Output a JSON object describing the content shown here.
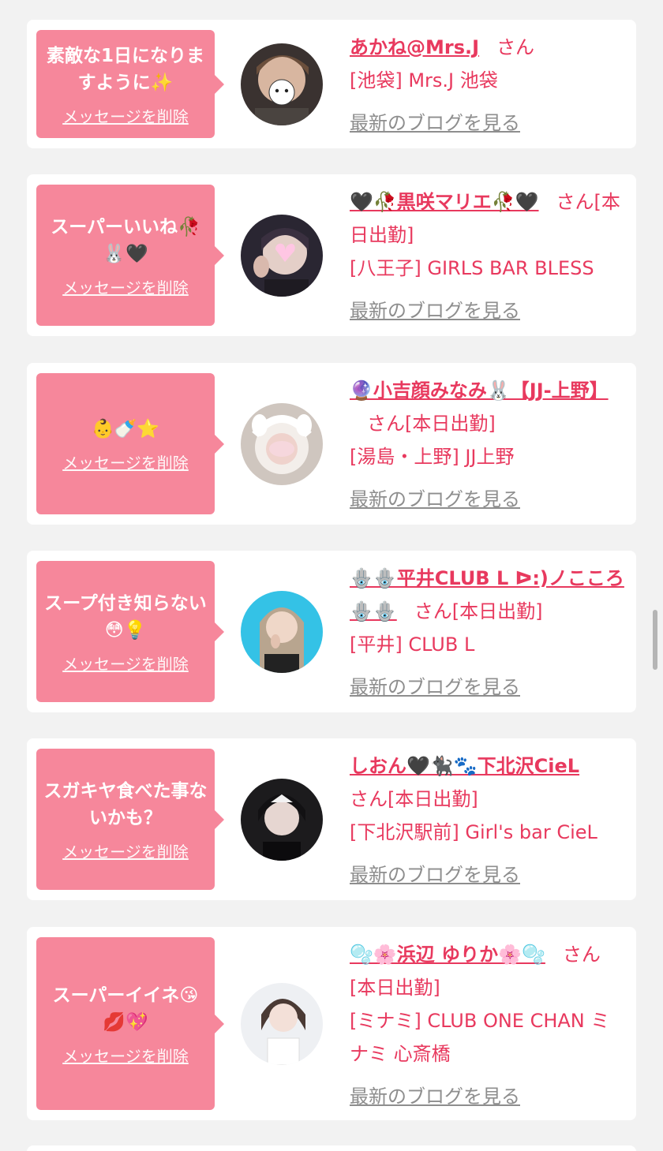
{
  "delete_label": "メッセージを削除",
  "blog_label": "最新のブログを見る",
  "san_label": "さん",
  "today_label": "[本日出勤]",
  "colors": {
    "bubble": "#f6879b",
    "name": "#e8395e",
    "blog": "#8e8e8e",
    "background": "#f2f2f2"
  },
  "items": [
    {
      "message": "素敵な1日になりますように✨",
      "name": "あかね@Mrs.J",
      "working_today": false,
      "store": "[池袋] Mrs.J 池袋",
      "avatar_icon": "profile-photo"
    },
    {
      "message": "スーパーいいね🥀🐰🖤",
      "name": "🖤🥀黒咲マリエ🥀🖤",
      "working_today": true,
      "store": "[八王子] GIRLS BAR BLESS",
      "avatar_icon": "profile-photo"
    },
    {
      "message": "👶🍼⭐",
      "name": "🔮小吉顔みなみ🐰【JJ-上野】",
      "working_today": true,
      "store": "[湯島・上野] JJ上野",
      "avatar_icon": "profile-photo"
    },
    {
      "message": "スープ付き知らない😳💡",
      "name": "🪬🪬平井CLUB L ᐅ:)ノこころ🪬🪬",
      "working_today": true,
      "store": "[平井] CLUB L",
      "avatar_icon": "profile-photo"
    },
    {
      "message": "スガキヤ食べた事ないかも？",
      "name": "しおん🖤🐈‍⬛🐾下北沢CieL",
      "working_today": true,
      "store": "[下北沢駅前] Girl's bar CieL",
      "avatar_icon": "profile-photo"
    },
    {
      "message": "スーパーイイネ😘💋💖",
      "name": "🫧🌸浜辺 ゆりか🌸🫧",
      "working_today": true,
      "store": "[ミナミ] CLUB ONE CHAN ミナミ 心斎橋",
      "avatar_icon": "profile-photo"
    }
  ]
}
